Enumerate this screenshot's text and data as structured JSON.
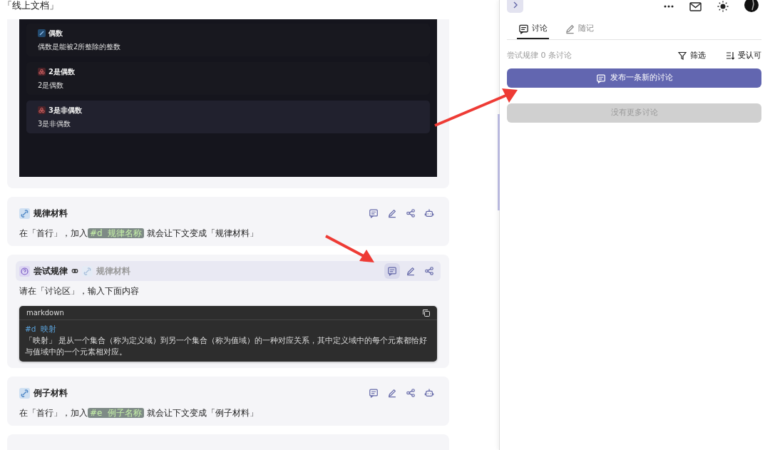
{
  "page_title": "「线上文档」",
  "cards": [
    {
      "kind": "image",
      "items": [
        {
          "kind": "definition",
          "title": "偶数",
          "text": "偶数是能被2所整除的整数",
          "highlighted": false
        },
        {
          "kind": "instance",
          "title": "2是偶数",
          "text": "2是偶数",
          "highlighted": false
        },
        {
          "kind": "instance",
          "title": "3是非偶数",
          "text": "3是非偶数",
          "highlighted": true
        }
      ]
    },
    {
      "kind": "note",
      "title": "规律材料",
      "body": {
        "before": "在「首行」，加入",
        "tag_hash": "#d",
        "tag_name": "规律名称",
        "after": "就会让下文变成「规律材料」"
      },
      "actions": [
        {
          "kind": "comment",
          "active": false
        },
        {
          "kind": "edit",
          "active": false
        },
        {
          "kind": "share",
          "active": false
        },
        {
          "kind": "robot",
          "active": false
        }
      ]
    },
    {
      "kind": "trial",
      "title": "尝试规律",
      "linked": "规律材料",
      "highlighted": true,
      "text": "请在「讨论区」，输入下面内容",
      "code": {
        "lang": "markdown",
        "hash": "#d",
        "heading": "映射",
        "text": "「映射」 是从一个集合（称为定义域）到另一个集合（称为值域）的一种对应关系，其中定义域中的每个元素都恰好与值域中的一个元素相对应。"
      },
      "actions": [
        {
          "kind": "comment",
          "active": true
        },
        {
          "kind": "edit",
          "active": false
        },
        {
          "kind": "share",
          "active": false
        }
      ]
    },
    {
      "kind": "note",
      "title": "例子材料",
      "body": {
        "before": "在「首行」，加入",
        "tag_hash": "#e",
        "tag_name": "例子名称",
        "after": "就会让下文变成「例子材料」"
      },
      "actions": [
        {
          "kind": "comment",
          "active": false
        },
        {
          "kind": "edit",
          "active": false
        },
        {
          "kind": "share",
          "active": false
        },
        {
          "kind": "robot",
          "active": false
        }
      ]
    },
    {
      "kind": "stub"
    }
  ],
  "panel": {
    "tabs": [
      {
        "label": "讨论",
        "kind": "comment",
        "selected": true
      },
      {
        "label": "随记",
        "kind": "edit",
        "selected": false
      }
    ],
    "summary": "尝试规律 0 条讨论",
    "filter": "筛选",
    "sort": "受认可",
    "new_button": "发布一条新的讨论",
    "more_button": {
      "label": "没有更多讨论",
      "disabled": true
    }
  }
}
